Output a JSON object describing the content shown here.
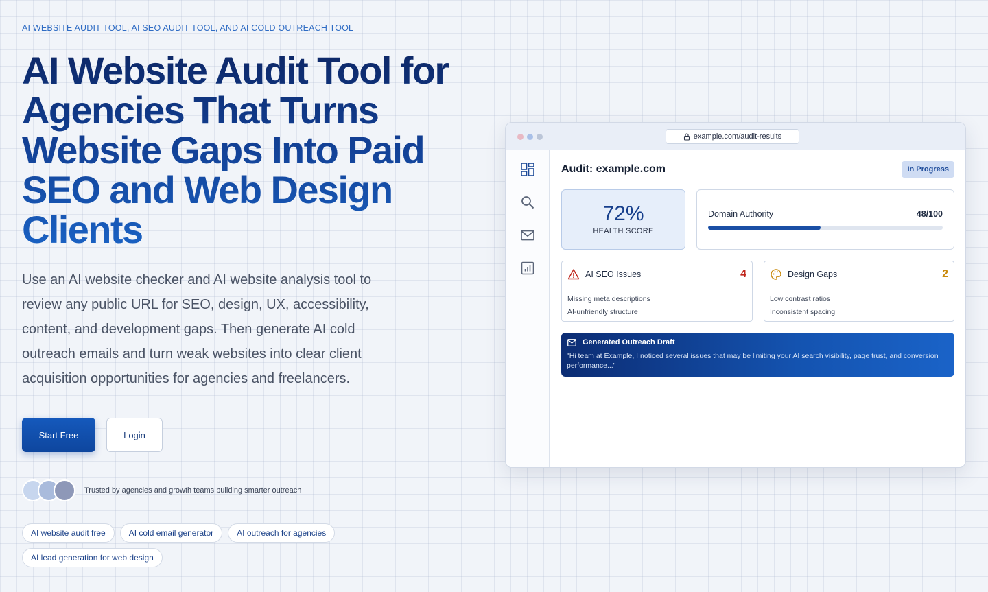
{
  "hero": {
    "eyebrow": "AI WEBSITE AUDIT TOOL, AI SEO AUDIT TOOL, AND AI COLD OUTREACH TOOL",
    "title": "AI Website Audit Tool for Agencies That Turns Website Gaps Into Paid SEO and Web Design Clients",
    "subtitle": "Use an AI website checker and AI website analysis tool to review any public URL for SEO, design, UX, accessibility, content, and development gaps. Then generate AI cold outreach emails and turn weak websites into clear client acquisition opportunities for agencies and freelancers.",
    "primary_cta": "Start Free",
    "secondary_cta": "Login",
    "trust_text": "Trusted by agencies and growth teams building smarter outreach"
  },
  "tags": [
    "AI website audit free",
    "AI cold email generator",
    "AI outreach for agencies",
    "AI lead generation for web design"
  ],
  "browser": {
    "url": "example.com/audit-results",
    "sidebar_icons": [
      "dashboard-icon",
      "search-icon",
      "mail-icon",
      "report-icon"
    ]
  },
  "audit": {
    "title": "Audit: example.com",
    "status": "In Progress",
    "health_score": "72%",
    "health_label": "HEALTH SCORE",
    "domain_authority_label": "Domain Authority",
    "domain_authority_value": "48/100",
    "domain_authority_fraction": 0.48,
    "seo_issues": {
      "title": "AI SEO Issues",
      "count": "4",
      "color": "#c0261d",
      "items": [
        "Missing meta descriptions",
        "AI-unfriendly structure"
      ]
    },
    "design_gaps": {
      "title": "Design Gaps",
      "count": "2",
      "color": "#c98a0c",
      "items": [
        "Low contrast ratios",
        "Inconsistent spacing"
      ]
    },
    "draft": {
      "title": "Generated Outreach Draft",
      "body": "\"Hi team at Example, I noticed several issues that may be limiting your AI search visibility, page trust, and conversion performance...\""
    }
  },
  "colors": {
    "brand": "#1559bc",
    "brand_dark": "#0d2766"
  }
}
